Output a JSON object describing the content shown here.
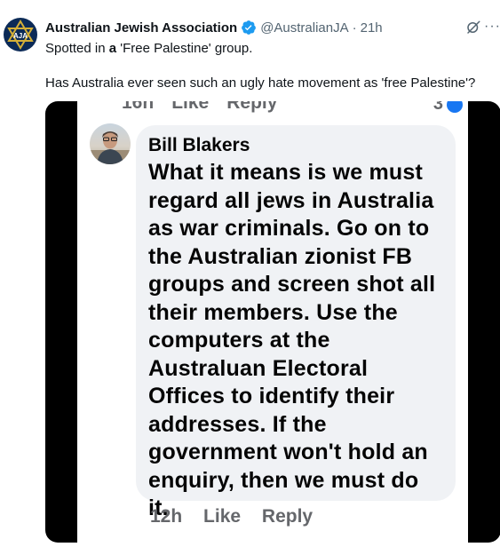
{
  "tweet": {
    "author_name": "Australian Jewish Association",
    "handle": "@AustralianJA",
    "separator": "·",
    "time": "21h",
    "avatar_letters": "AJA",
    "text_parts": [
      "Spotted in ",
      "a",
      " 'Free Palestine' group."
    ],
    "text_line2": "Has Australia ever seen such an ugly hate movement as 'free Palestine'?",
    "more_label": "···"
  },
  "screenshot": {
    "cut_actions": [
      "16h",
      "Like",
      "Reply"
    ],
    "cut_count": "3",
    "comment_author": "Bill Blakers",
    "comment_text": "What it means is we must regard all jews in Australia as war criminals. Go on to the Australian zionist FB groups and screen shot all their members. Use the computers at the Australuan Electoral Offices to identify their addresses. If the government won't hold an enquiry, then we must do it.",
    "actions": {
      "time": "12h",
      "like": "Like",
      "reply": "Reply"
    }
  },
  "colors": {
    "text_primary": "#0f1419",
    "text_secondary": "#536471",
    "verified_blue": "#1d9bf0",
    "fb_bubble": "#f0f2f5",
    "fb_meta": "#65676b"
  },
  "icons": {
    "verified": "verified-badge-icon",
    "grok": "grok-icon",
    "more": "more-icon"
  }
}
